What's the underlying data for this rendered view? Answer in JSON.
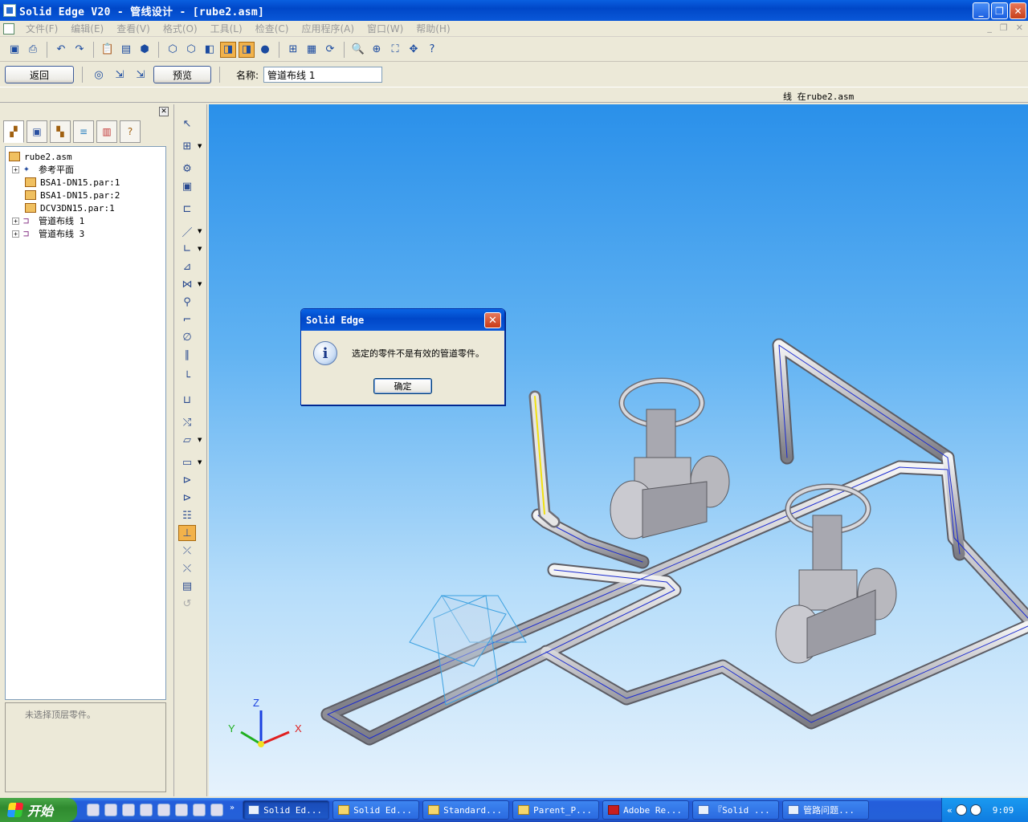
{
  "window": {
    "title": "Solid Edge V20 - 管线设计 - [rube2.asm]"
  },
  "menu": [
    "文件(F)",
    "编辑(E)",
    "查看(V)",
    "格式(O)",
    "工具(L)",
    "检查(C)",
    "应用程序(A)",
    "窗口(W)",
    "帮助(H)"
  ],
  "route_bar": {
    "back_label": "返回",
    "preview_label": "预览",
    "name_label": "名称:",
    "name_value": "管道布线 1"
  },
  "status": {
    "text": "线 在rube2.asm"
  },
  "tree": {
    "items": [
      {
        "label": "rube2.asm",
        "icon": "assembly-icon"
      },
      {
        "label": "参考平面",
        "icon": "reference-planes-icon"
      },
      {
        "label": "BSA1-DN15.par:1",
        "icon": "part-icon"
      },
      {
        "label": "BSA1-DN15.par:2",
        "icon": "part-icon"
      },
      {
        "label": "DCV3DN15.par:1",
        "icon": "part-icon"
      },
      {
        "label": "管道布线 1",
        "icon": "route-icon"
      },
      {
        "label": "管道布线 3",
        "icon": "route-icon"
      }
    ]
  },
  "message_pane": {
    "text": "未选择顶层零件。"
  },
  "dialog": {
    "title": "Solid Edge",
    "message": "选定的零件不是有效的管道零件。",
    "ok_label": "确定"
  },
  "triad": {
    "x": "X",
    "y": "Y",
    "z": "Z"
  },
  "taskbar": {
    "start_label": "开始",
    "tasks": [
      "Solid Ed...",
      "Solid Ed...",
      "Standard...",
      "Parent_P...",
      "Adobe Re...",
      "『Solid ...",
      "管路问题..."
    ],
    "clock": "9:09"
  },
  "colors": {
    "titlebar": "#0a58d8",
    "viewport_top": "#2a90ea",
    "viewport_bottom": "#e6f2fc",
    "active_tool": "#f2b24a"
  }
}
